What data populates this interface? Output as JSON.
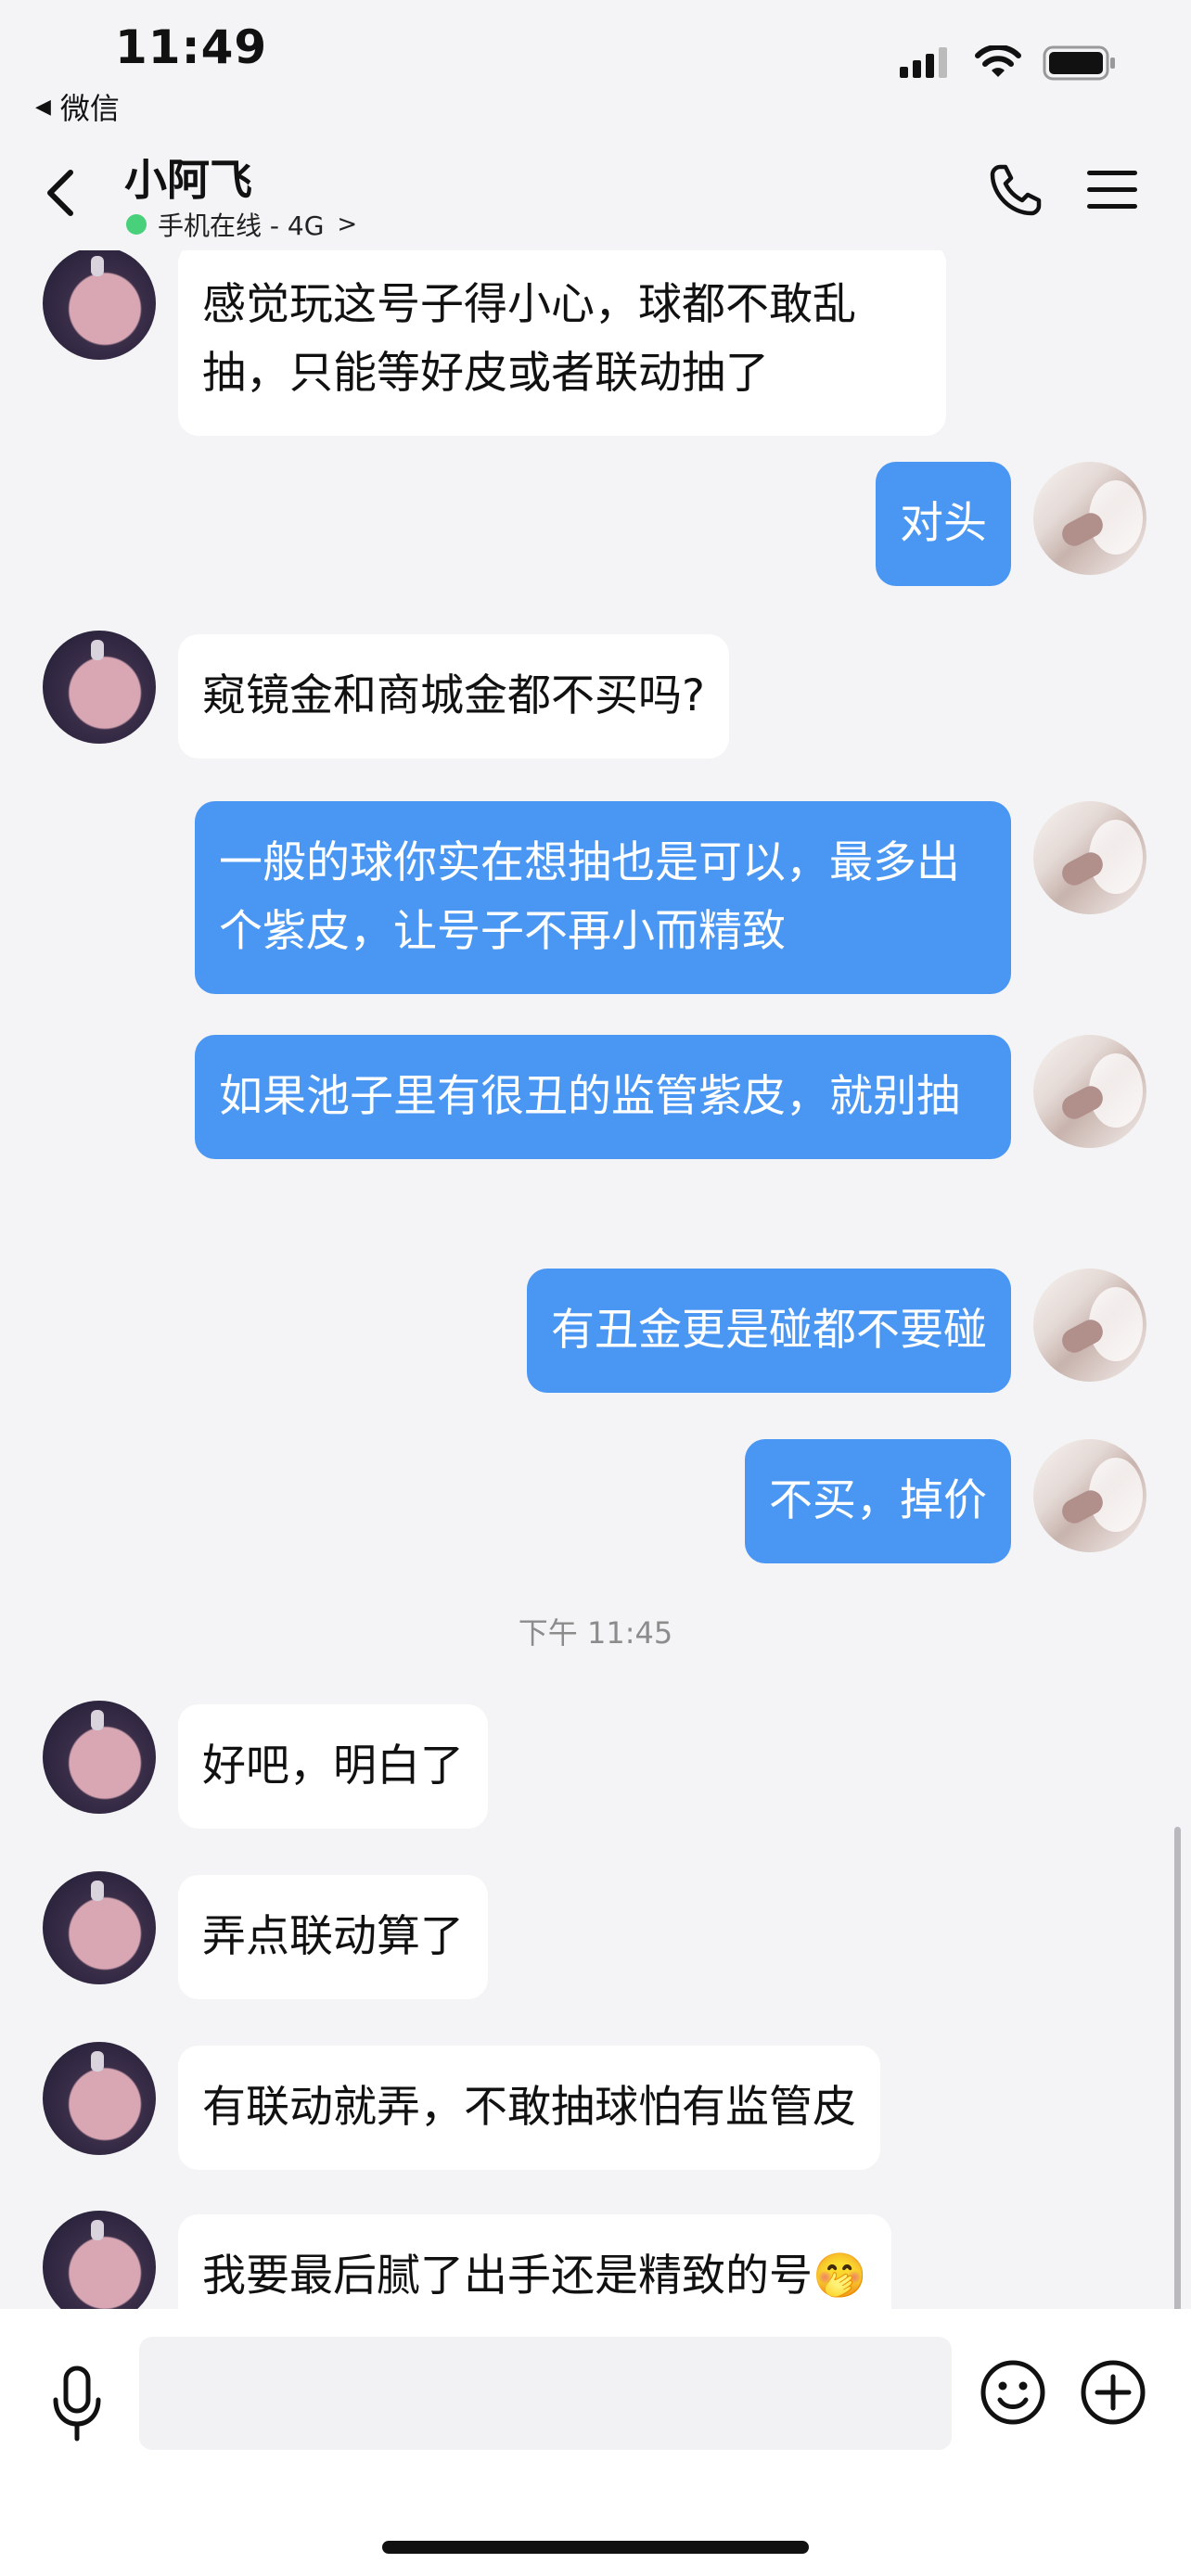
{
  "status_bar": {
    "time": "11:49",
    "back_app": "微信",
    "icons": [
      "signal-icon",
      "wifi-icon",
      "battery-icon"
    ]
  },
  "nav": {
    "contact_name": "小阿飞",
    "contact_status": "手机在线 - 4G",
    "status_color": "#49d07a",
    "icons": [
      "back-arrow-icon",
      "phone-icon",
      "menu-icon"
    ]
  },
  "messages": [
    {
      "side": "them",
      "text": "感觉玩这号子得小心，球都不敢乱抽，只能等好皮或者联动抽了"
    },
    {
      "side": "me",
      "text": "对头"
    },
    {
      "side": "them",
      "text": "窥镜金和商城金都不买吗?"
    },
    {
      "side": "me",
      "text": "一般的球你实在想抽也是可以，最多出个紫皮，让号子不再小而精致"
    },
    {
      "side": "me",
      "text": "如果池子里有很丑的监管紫皮，就别抽"
    },
    {
      "side": "me",
      "text": "有丑金更是碰都不要碰"
    },
    {
      "side": "me",
      "text": "不买，掉价"
    },
    {
      "timestamp": "下午 11:45"
    },
    {
      "side": "them",
      "text": "好吧，明白了"
    },
    {
      "side": "them",
      "text": "弄点联动算了"
    },
    {
      "side": "them",
      "text": "有联动就弄，不敢抽球怕有监管皮"
    },
    {
      "side": "them",
      "text": "我要最后腻了出手还是精致的号",
      "emoji": "🤭"
    }
  ],
  "input_bar": {
    "placeholder": "",
    "icons": [
      "microphone-icon",
      "emoji-icon",
      "plus-icon"
    ]
  },
  "colors": {
    "my_bubble": "#4a97f3",
    "their_bubble": "#ffffff",
    "background": "#f4f4f6"
  }
}
